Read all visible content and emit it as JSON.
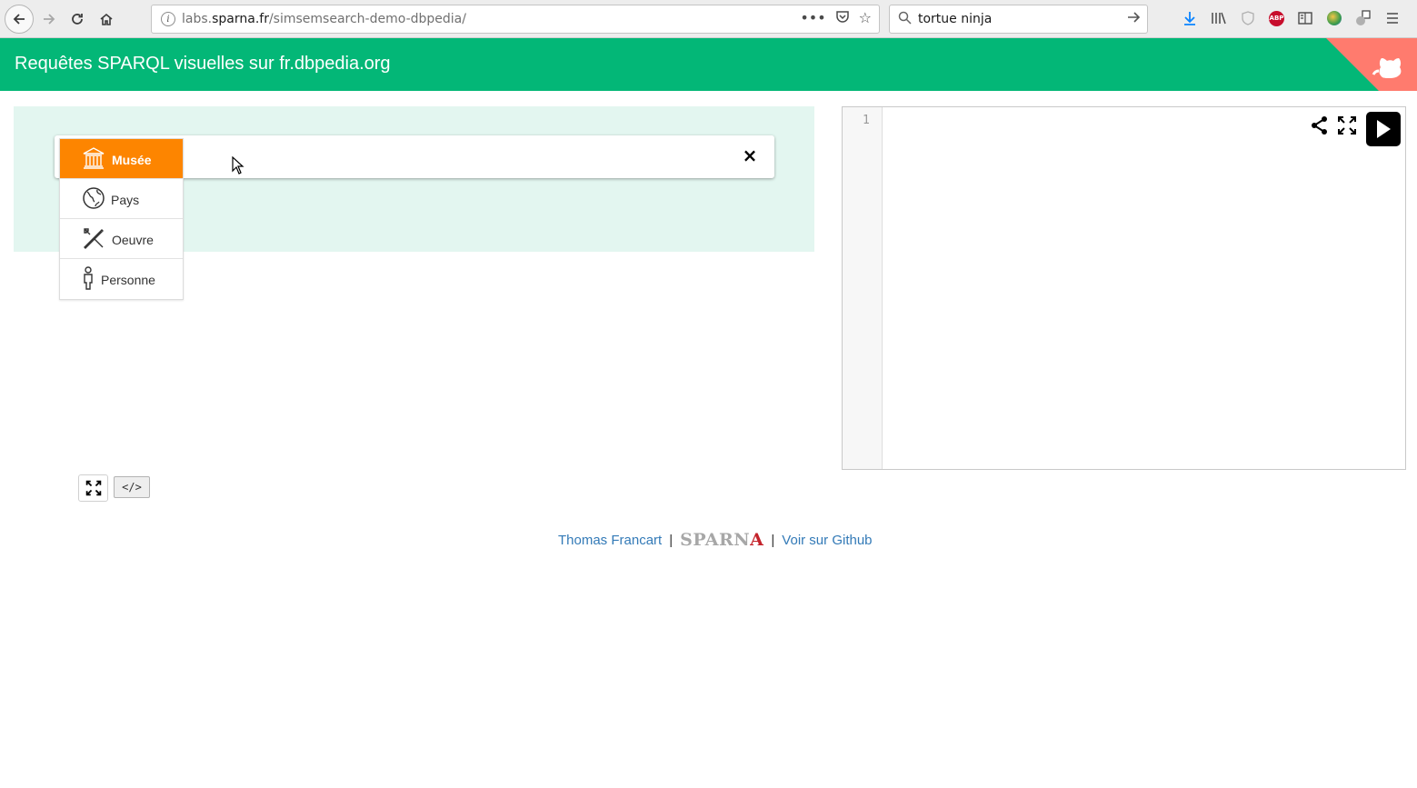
{
  "browser": {
    "url_prefix": "labs.",
    "url_host": "sparna.fr",
    "url_path": "/simsemsearch-demo-dbpedia/",
    "search_value": "tortue ninja",
    "abp_label": "ABP"
  },
  "header": {
    "title": "Requêtes SPARQL visuelles sur fr.dbpedia.org"
  },
  "builder": {
    "types": [
      {
        "label": "Musée",
        "icon": "museum-icon",
        "selected": true
      },
      {
        "label": "Pays",
        "icon": "globe-icon",
        "selected": false
      },
      {
        "label": "Oeuvre",
        "icon": "artwork-icon",
        "selected": false
      },
      {
        "label": "Personne",
        "icon": "person-icon",
        "selected": false
      }
    ],
    "remove_label": "×"
  },
  "editor": {
    "line_number": "1"
  },
  "controls": {
    "code_label": "</>"
  },
  "footer": {
    "author_link": "Thomas Francart",
    "separator": "|",
    "logo_text_main": "SPARN",
    "logo_text_accent": "A",
    "github_link": "Voir sur Github"
  },
  "colors": {
    "header_bg": "#03b777",
    "builder_bg": "#e3f6f0",
    "selected_item": "#fd8500",
    "github_corner": "#ff7b6e",
    "link": "#337ab7"
  }
}
